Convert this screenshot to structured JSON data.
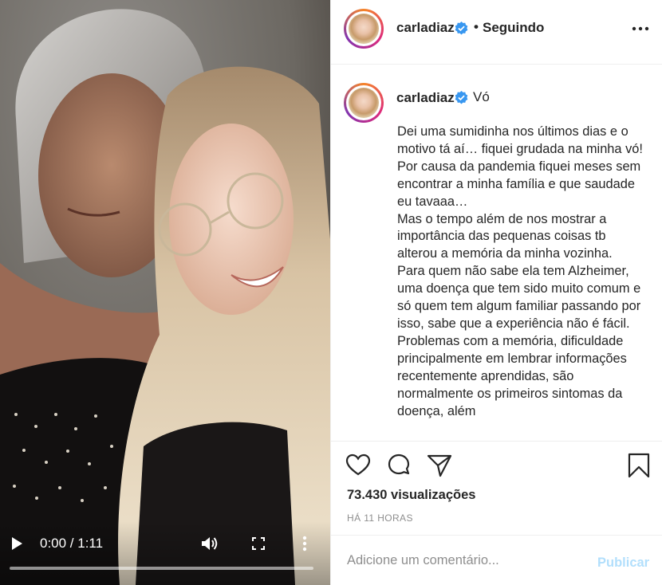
{
  "video": {
    "time": "0:00 / 1:11",
    "progress": 0.0
  },
  "header": {
    "username": "carladiaz",
    "separator": "•",
    "follow_state": "Seguindo"
  },
  "caption": {
    "username": "carladiaz",
    "title": "Vó",
    "text": "Dei uma sumidinha nos últimos dias e o motivo tá aí… fiquei grudada na minha vó! Por causa da pandemia fiquei meses sem encontrar a minha família e que saudade eu tavaaa…\nMas o tempo além de nos mostrar a importância das pequenas coisas tb alterou a memória da minha vozinha.\nPara quem não sabe ela tem Alzheimer, uma doença que tem sido muito comum e só quem tem algum familiar passando por isso, sabe que a experiência não é fácil.\nProblemas com a memória, dificuldade principalmente em lembrar informações recentemente aprendidas, são normalmente os primeiros sintomas da doença, além"
  },
  "stats": {
    "views": "73.430 visualizações",
    "when": "HÁ 11 HORAS"
  },
  "comment": {
    "placeholder": "Adicione um comentário...",
    "publish_label": "Publicar"
  },
  "colors": {
    "verified": "#3897f0",
    "publish_disabled": "#b2dffc",
    "muted_text": "#8e8e8e"
  },
  "icons": {
    "play": "play-icon",
    "volume": "volume-icon",
    "fullscreen": "fullscreen-icon",
    "more": "more-vertical-icon",
    "header_more": "more-horizontal-icon",
    "like": "heart-icon",
    "comment": "comment-icon",
    "share": "send-icon",
    "save": "bookmark-icon",
    "verified": "verified-badge-icon"
  }
}
